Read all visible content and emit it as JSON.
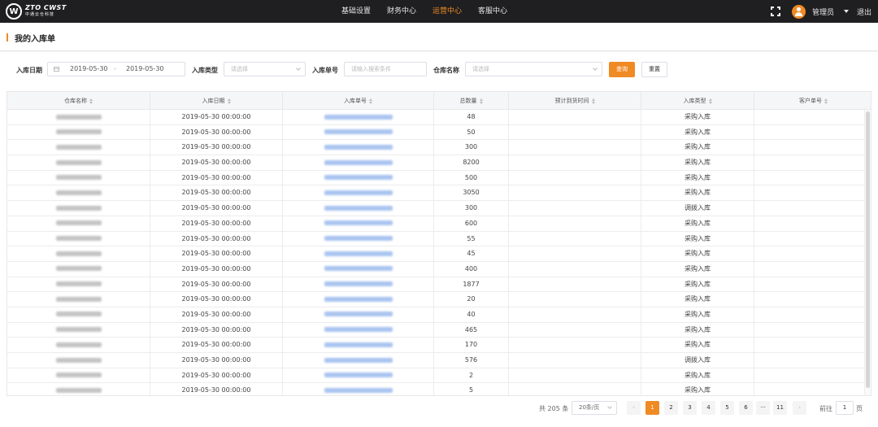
{
  "brand": {
    "logo_mark": "W",
    "line1": "ZTO CWST",
    "line2": "中通云仓科技"
  },
  "nav": {
    "items": [
      {
        "label": "基础设置"
      },
      {
        "label": "财务中心"
      },
      {
        "label": "运营中心"
      },
      {
        "label": "客服中心"
      }
    ],
    "active": "运营中心"
  },
  "user": {
    "name": "管理员",
    "logout": "退出",
    "icons": [
      "fullscreen-icon",
      "user-avatar-icon",
      "caret-down-icon"
    ]
  },
  "page": {
    "title": "我的入库单"
  },
  "filters": {
    "date_label": "入库日期",
    "date_start": "2019-05-30",
    "date_sep": "-",
    "date_end": "2019-05-30",
    "type_label": "入库类型",
    "type_placeholder": "请选择",
    "no_label": "入库单号",
    "no_placeholder": "请输入搜索条件",
    "warehouse_label": "仓库名称",
    "warehouse_placeholder": "请选择",
    "search_btn": "查询",
    "reset_btn": "重置"
  },
  "table": {
    "columns": [
      "仓库名称",
      "入库日期",
      "入库单号",
      "总数量",
      "预计到货时间",
      "入库类型",
      "客户单号"
    ],
    "rows": [
      {
        "date": "2019-05-30 00:00:00",
        "qty": "48",
        "type": "采购入库"
      },
      {
        "date": "2019-05-30 00:00:00",
        "qty": "50",
        "type": "采购入库"
      },
      {
        "date": "2019-05-30 00:00:00",
        "qty": "300",
        "type": "采购入库"
      },
      {
        "date": "2019-05-30 00:00:00",
        "qty": "8200",
        "type": "采购入库"
      },
      {
        "date": "2019-05-30 00:00:00",
        "qty": "500",
        "type": "采购入库"
      },
      {
        "date": "2019-05-30 00:00:00",
        "qty": "3050",
        "type": "采购入库"
      },
      {
        "date": "2019-05-30 00:00:00",
        "qty": "300",
        "type": "调拨入库"
      },
      {
        "date": "2019-05-30 00:00:00",
        "qty": "600",
        "type": "采购入库"
      },
      {
        "date": "2019-05-30 00:00:00",
        "qty": "55",
        "type": "采购入库"
      },
      {
        "date": "2019-05-30 00:00:00",
        "qty": "45",
        "type": "采购入库"
      },
      {
        "date": "2019-05-30 00:00:00",
        "qty": "400",
        "type": "采购入库"
      },
      {
        "date": "2019-05-30 00:00:00",
        "qty": "1877",
        "type": "采购入库"
      },
      {
        "date": "2019-05-30 00:00:00",
        "qty": "20",
        "type": "采购入库"
      },
      {
        "date": "2019-05-30 00:00:00",
        "qty": "40",
        "type": "采购入库"
      },
      {
        "date": "2019-05-30 00:00:00",
        "qty": "465",
        "type": "采购入库"
      },
      {
        "date": "2019-05-30 00:00:00",
        "qty": "170",
        "type": "采购入库"
      },
      {
        "date": "2019-05-30 00:00:00",
        "qty": "576",
        "type": "调拨入库"
      },
      {
        "date": "2019-05-30 00:00:00",
        "qty": "2",
        "type": "采购入库"
      },
      {
        "date": "2019-05-30 00:00:00",
        "qty": "5",
        "type": "采购入库"
      }
    ]
  },
  "pagination": {
    "total_text": "共 205 条",
    "page_size": "20条/页",
    "prev": "‹",
    "pages": [
      "1",
      "2",
      "3",
      "4",
      "5",
      "6",
      "···",
      "11"
    ],
    "active_page": "1",
    "next": "›",
    "goto_label": "前往",
    "goto_value": "1",
    "goto_unit": "页"
  },
  "colors": {
    "accent": "#f08a24",
    "topbar": "#1f1f21",
    "link_blur": "#a9c4f0"
  }
}
